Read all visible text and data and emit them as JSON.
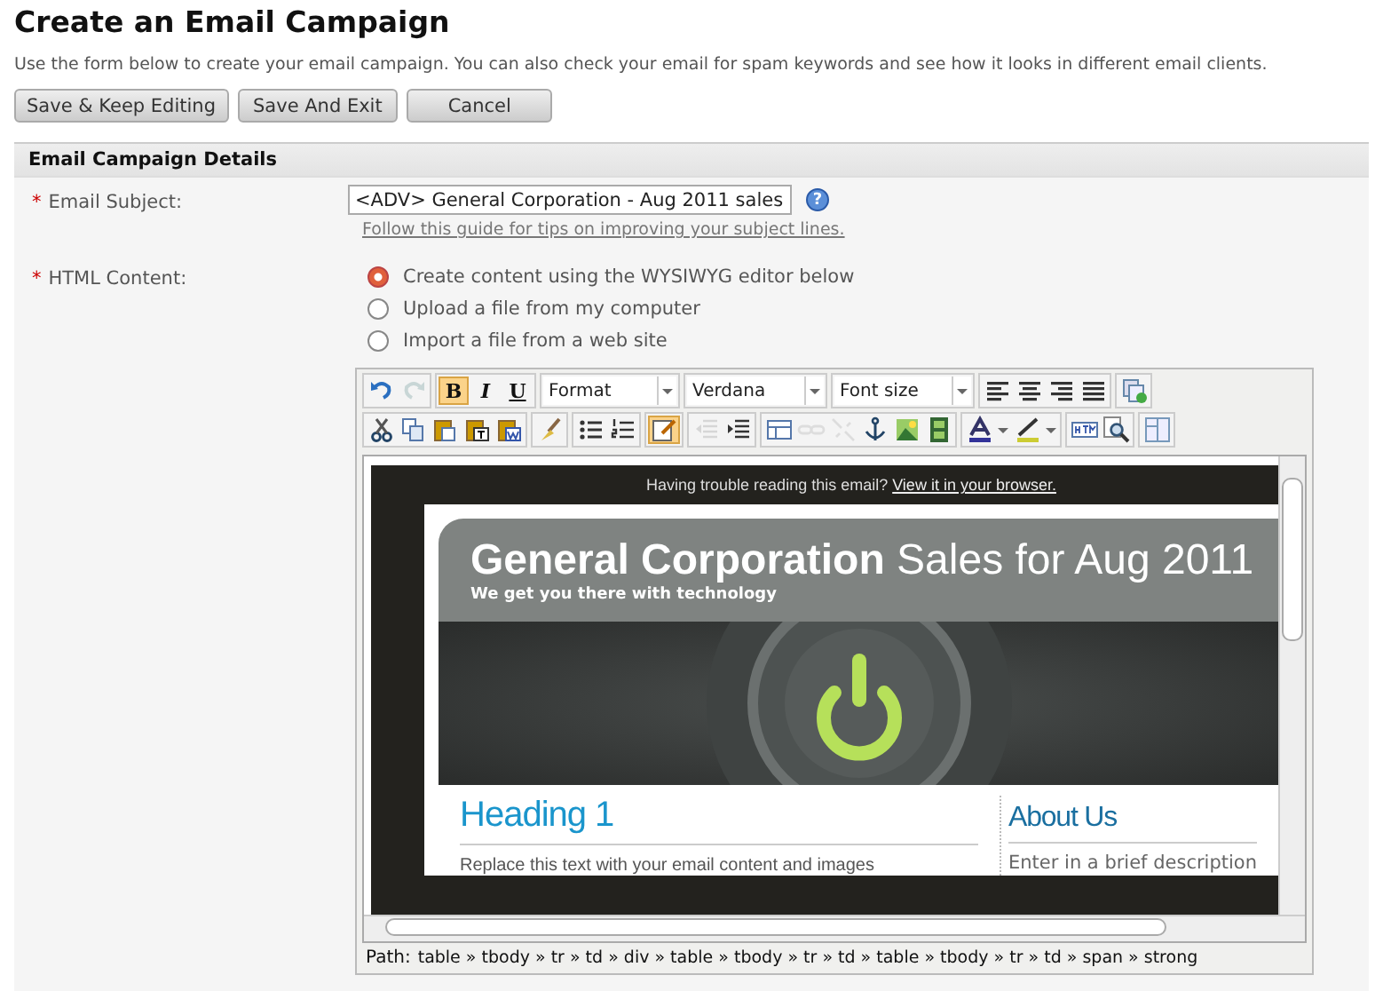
{
  "page": {
    "title": "Create an Email Campaign",
    "description": "Use the form below to create your email campaign. You can also check your email for spam keywords and see how it looks in different email clients."
  },
  "buttons": [
    "Save & Keep Editing",
    "Save And Exit",
    "Cancel"
  ],
  "section": {
    "title": "Email Campaign Details"
  },
  "subject": {
    "marker": "*",
    "label": "Email Subject:",
    "value": "<ADV> General Corporation - Aug 2011 sales",
    "help_icon": "?",
    "help_link": "Follow this guide for tips on improving your subject lines."
  },
  "html_content": {
    "marker": "*",
    "label": "HTML Content:",
    "options": [
      {
        "label": "Create content using the WYSIWYG editor below",
        "selected": true
      },
      {
        "label": "Upload a file from my computer",
        "selected": false
      },
      {
        "label": "Import a file from a web site",
        "selected": false
      }
    ]
  },
  "editor": {
    "toolbar": [
      [
        [
          {
            "kind": "icon",
            "active": false,
            "disabled": false
          },
          {
            "kind": "icon",
            "active": false,
            "disabled": true
          }
        ],
        [
          {
            "kind": "text",
            "label": "B",
            "active": true,
            "disabled": false
          },
          {
            "kind": "text",
            "label": "I",
            "active": false,
            "disabled": false
          },
          {
            "kind": "text",
            "label": "U",
            "active": false,
            "disabled": false
          }
        ],
        [
          {
            "kind": "select",
            "value": "Format"
          }
        ],
        [
          {
            "kind": "select",
            "value": "Verdana"
          }
        ],
        [
          {
            "kind": "select",
            "value": "Font size"
          }
        ],
        [
          {
            "kind": "icon",
            "active": false,
            "disabled": false
          },
          {
            "kind": "icon",
            "active": false,
            "disabled": false
          },
          {
            "kind": "icon",
            "active": false,
            "disabled": false
          },
          {
            "kind": "icon",
            "active": false,
            "disabled": false
          }
        ],
        [
          {
            "kind": "icon",
            "active": false,
            "disabled": false
          }
        ]
      ],
      [
        [
          {
            "kind": "icon",
            "active": false,
            "disabled": false
          },
          {
            "kind": "icon",
            "active": false,
            "disabled": false
          },
          {
            "kind": "icon",
            "active": false,
            "disabled": false
          },
          {
            "kind": "icon",
            "active": false,
            "disabled": false
          },
          {
            "kind": "icon",
            "active": false,
            "disabled": false
          }
        ],
        [
          {
            "kind": "icon",
            "active": false,
            "disabled": false
          }
        ],
        [
          {
            "kind": "icon",
            "active": false,
            "disabled": false
          },
          {
            "kind": "icon",
            "active": false,
            "disabled": false
          }
        ],
        [
          {
            "kind": "icon",
            "active": true,
            "disabled": false
          }
        ],
        [
          {
            "kind": "icon",
            "active": false,
            "disabled": true
          },
          {
            "kind": "icon",
            "active": false,
            "disabled": false
          }
        ],
        [
          {
            "kind": "icon",
            "active": false,
            "disabled": false
          },
          {
            "kind": "icon",
            "active": false,
            "disabled": true
          },
          {
            "kind": "icon",
            "active": false,
            "disabled": true
          },
          {
            "kind": "icon",
            "active": false,
            "disabled": false
          },
          {
            "kind": "icon",
            "active": false,
            "disabled": false
          },
          {
            "kind": "icon",
            "active": false,
            "disabled": false
          }
        ],
        [
          {
            "kind": "menu",
            "active": false,
            "disabled": false
          },
          {
            "kind": "menu",
            "active": false,
            "disabled": false
          }
        ],
        [
          {
            "kind": "icon",
            "active": false,
            "disabled": false
          },
          {
            "kind": "icon",
            "active": false,
            "disabled": false
          }
        ],
        [
          {
            "kind": "icon",
            "active": false,
            "disabled": false
          }
        ]
      ]
    ],
    "email": {
      "notice": "Having trouble reading this email?",
      "notice_link": "View it in your browser.",
      "headline": "**General Corporation** Sales for Aug 2011",
      "tagline": "We get you there with technology",
      "heading": "Heading 1",
      "body": "Replace this text with your email content and images",
      "side_heading": "About Us",
      "side_text": "Enter in a brief description"
    },
    "path_label": "Path:",
    "path": "table » tbody » tr » td » div » table » tbody » tr » td » table » tbody » tr » td » span » strong"
  }
}
